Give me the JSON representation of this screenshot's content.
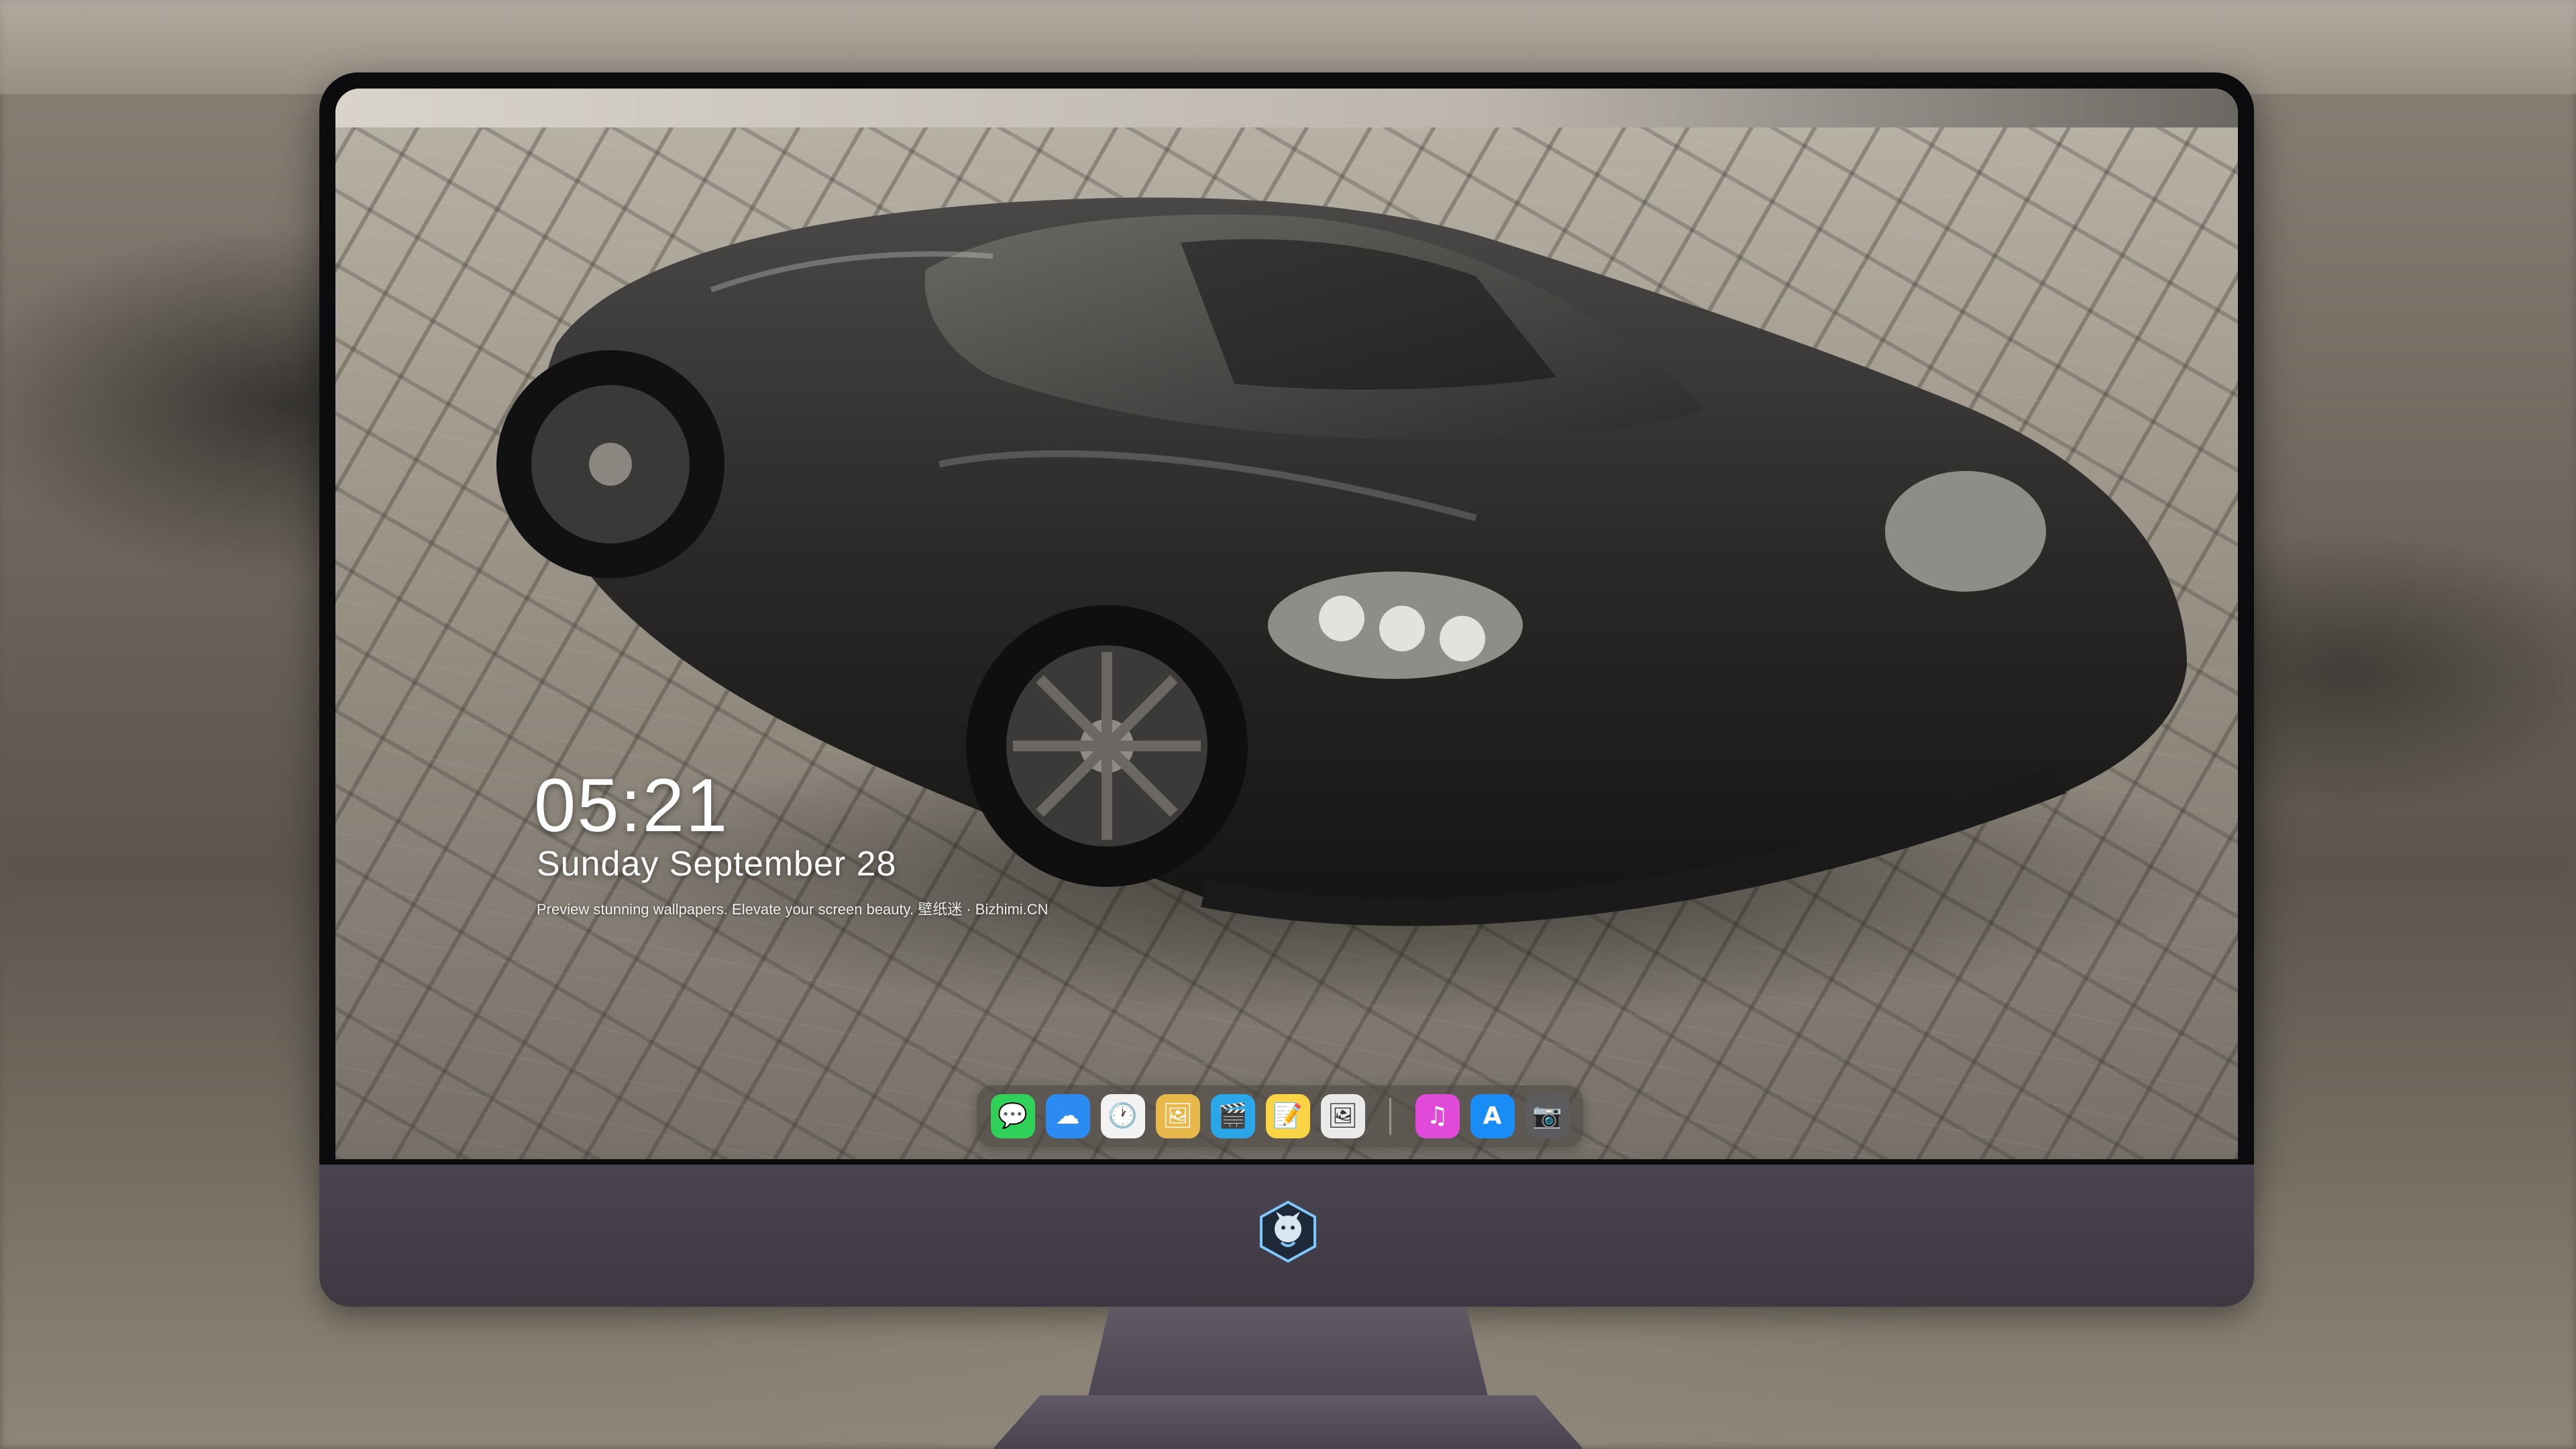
{
  "lock_screen": {
    "time": "05:21",
    "date": "Sunday September  28",
    "tagline": "Preview stunning wallpapers. Elevate your screen beauty. 壁纸迷 · Bizhimi.CN"
  },
  "dock": {
    "apps": [
      {
        "name": "Messages",
        "icon": "messages-icon",
        "color": "#30d158",
        "glyph": "💬"
      },
      {
        "name": "Weather",
        "icon": "weather-icon",
        "color": "#2b8bf2",
        "glyph": "☁"
      },
      {
        "name": "Clock",
        "icon": "clock-icon",
        "color": "#f2f2f2",
        "glyph": "🕐"
      },
      {
        "name": "Preview",
        "icon": "preview-icon",
        "color": "#e8b84a",
        "glyph": "🖼"
      },
      {
        "name": "Clips",
        "icon": "clips-icon",
        "color": "#2aa7e8",
        "glyph": "🎬"
      },
      {
        "name": "Notes",
        "icon": "notes-icon",
        "color": "#fbd446",
        "glyph": "📝"
      },
      {
        "name": "Photos",
        "icon": "photos-icon",
        "color": "#e9e9e9",
        "glyph": "🖼"
      },
      {
        "name": "Music",
        "icon": "music-icon",
        "color": "#e14ad8",
        "glyph": "♫"
      },
      {
        "name": "App Store",
        "icon": "app-store-icon",
        "color": "#1a8cf5",
        "glyph": "A"
      },
      {
        "name": "Camera",
        "icon": "camera-icon",
        "color": "#5c5c5e",
        "glyph": "📷"
      }
    ]
  }
}
